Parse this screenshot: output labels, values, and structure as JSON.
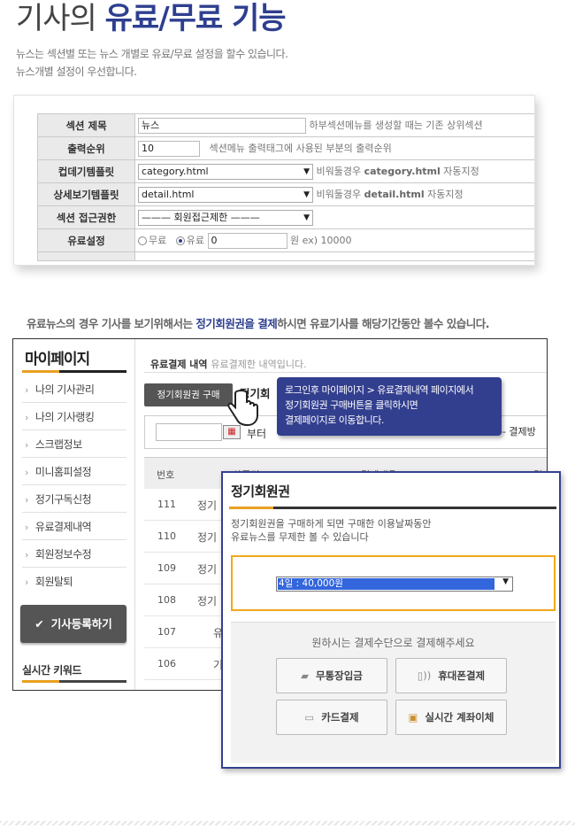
{
  "header": {
    "title_prefix": "기사의 ",
    "title_highlight": "유료/무료 기능",
    "desc_line1": "뉴스는 섹션별 또는 뉴스 개별로 유료/무료 설정을 할수 있습니다.",
    "desc_line2": "뉴스개별 설정이 우선합니다."
  },
  "settings": {
    "section_title_label": "섹션 제목",
    "section_title_value": "뉴스",
    "section_title_hint": "하부섹션메뉴를 생성할 때는 기존 상위섹션",
    "order_label": "출력순위",
    "order_value": "10",
    "order_hint": "섹션메뉴 출력태그에 사용된 부분의 출력순위",
    "container_label": "컵데기템플릿",
    "container_value": "category.html",
    "container_hint_prefix": "비워둘경우 ",
    "container_hint_file": "category.html",
    "container_hint_suffix": " 자동지정",
    "detail_label": "상세보기템플릿",
    "detail_value": "detail.html",
    "detail_hint_prefix": "비워둘경우 ",
    "detail_hint_file": "detail.html",
    "detail_hint_suffix": " 자동지정",
    "access_label": "섹션 접근권한",
    "access_value": "——— 회원접근제한 ———",
    "pay_label": "유료설정",
    "pay_free": "무료",
    "pay_paid": "유료",
    "pay_amount": "0",
    "pay_unit": "원 ex) 10000",
    "selected_option": "paid"
  },
  "note": {
    "prefix": "유료뉴스의 경우 기사를 보기위해서는 ",
    "highlight": "정기회원권을 결제",
    "suffix": "하시면 유료기사를 해당기간동안 볼수 있습니다."
  },
  "mypage": {
    "title": "마이페이지",
    "menu": [
      "나의 기사관리",
      "나의 기사랭킹",
      "스크랩정보",
      "미니홈피설정",
      "정기구독신청",
      "유료결제내역",
      "회원정보수정",
      "회원탈퇴"
    ],
    "register_button": "기사등록하기",
    "keyword_title": "실시간 키워드",
    "pay_history_title": "유료결제 내역",
    "pay_history_sub": "유료결제한 내역입니다.",
    "buy_button": "정기회원권 구매",
    "sub_tab": "정기회",
    "from_label": "부터",
    "status_select": "-- 결제방",
    "col_no": "번호",
    "col_product": "상품명",
    "col_content": "결제내용",
    "col_date": "결제",
    "rows": [
      {
        "no": "111",
        "product": "정기"
      },
      {
        "no": "110",
        "product": "정기"
      },
      {
        "no": "109",
        "product": "정기"
      },
      {
        "no": "108",
        "product": "정기"
      },
      {
        "no": "107",
        "product": "유"
      },
      {
        "no": "106",
        "product": "기"
      }
    ]
  },
  "callout": {
    "line1": "로그인후 마이페이지 > 유료결제내역 페이지에서",
    "line2": "정기회원권 구매버튼을 클릭하시면",
    "line3": "결제페이지로 이동합니다."
  },
  "popup": {
    "title": "정기회원권",
    "desc_line1": "정기회원권을 구매하게 되면 구매한 이용날짜동안",
    "desc_line2": "유료뉴스를 무제한 볼 수 있습니다",
    "plan_value": "4일 : 40,000원",
    "pay_prompt": "원하시는 결제수단으로 결제해주세요",
    "btn_bank": "무통장입금",
    "btn_phone": "휴대폰결제",
    "btn_card": "카드결제",
    "btn_realtime": "실시간 계좌이체"
  },
  "colors": {
    "accent": "#2e3f8f",
    "callout_bg": "#323e8e",
    "highlight_orange": "#f0a818"
  }
}
